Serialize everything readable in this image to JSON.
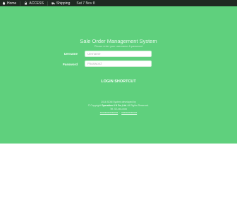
{
  "topbar": {
    "home_label": "Home",
    "item2_label": "ACCESS",
    "item3_label": "Shipping",
    "date_label": "Sat 7 Nov 8"
  },
  "main": {
    "title": "Sale Order Management System",
    "subtitle": "Please enter your username & password"
  },
  "form": {
    "username_label": "Uername",
    "username_placeholder": "Uername",
    "password_label": "Password",
    "password_placeholder": "Password",
    "login_label": "LOGIN SHORTCUT"
  },
  "footer": {
    "line1": "2016 SOM System developed by",
    "line2_prefix": "© Copyright",
    "line2_company": "Operation 4 U Co.,Ltd.",
    "line2_suffix": "All Rights Reserved.",
    "line3": "Tel. 02-xxx-xxxx",
    "link1": "xxxxxxxxxxxxxxx",
    "link2": "xxxxxxxxxxxxx"
  },
  "colors": {
    "topbar_bg": "#1f2a22",
    "main_bg": "#5fd07d"
  }
}
